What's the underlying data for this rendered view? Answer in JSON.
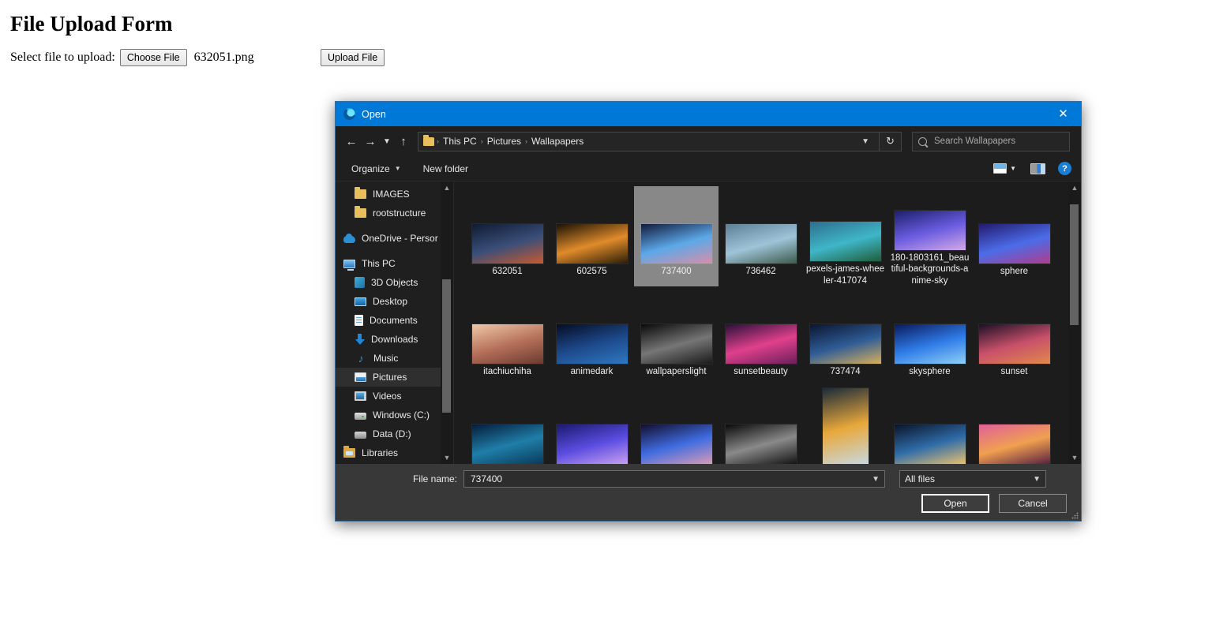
{
  "page": {
    "title": "File Upload Form",
    "select_label": "Select file to upload:",
    "choose_file_label": "Choose File",
    "chosen_file_name": "632051.png",
    "upload_button_label": "Upload File"
  },
  "dialog": {
    "title": "Open",
    "app_icon": "edge-browser-icon",
    "close_icon": "close-icon",
    "nav": {
      "back_icon": "back-arrow-icon",
      "forward_icon": "forward-arrow-icon",
      "recent_icon": "chevron-down-icon",
      "up_icon": "up-arrow-icon",
      "refresh_icon": "refresh-icon",
      "breadcrumb_caret": "chevron-down-icon"
    },
    "breadcrumb": [
      "This PC",
      "Pictures",
      "Wallapapers"
    ],
    "breadcrumb_separator": "›",
    "search": {
      "placeholder": "Search Wallapapers",
      "value": "",
      "icon": "search-icon"
    },
    "command_bar": {
      "organize_label": "Organize",
      "new_folder_label": "New folder",
      "view_icon": "view-layout-icon",
      "view_caret": "chevron-down-icon",
      "preview_pane_icon": "preview-pane-icon",
      "help_icon": "help-icon",
      "help_glyph": "?"
    },
    "nav_tree": [
      {
        "label": "IMAGES",
        "icon": "folder-icon",
        "kind": "folder",
        "indent": true,
        "selected": false
      },
      {
        "label": "rootstructure",
        "icon": "folder-icon",
        "kind": "folder",
        "indent": true,
        "selected": false
      },
      {
        "label": "",
        "icon": "spacer",
        "kind": "spacer",
        "indent": false,
        "selected": false
      },
      {
        "label": "OneDrive - Persor",
        "icon": "cloud-icon",
        "kind": "cloud",
        "indent": false,
        "selected": false
      },
      {
        "label": "",
        "icon": "spacer",
        "kind": "spacer",
        "indent": false,
        "selected": false
      },
      {
        "label": "This PC",
        "icon": "computer-icon",
        "kind": "pc",
        "indent": false,
        "selected": false
      },
      {
        "label": "3D Objects",
        "icon": "3d-objects-icon",
        "kind": "objects3d",
        "indent": true,
        "selected": false
      },
      {
        "label": "Desktop",
        "icon": "desktop-icon",
        "kind": "desktop",
        "indent": true,
        "selected": false
      },
      {
        "label": "Documents",
        "icon": "documents-icon",
        "kind": "docs",
        "indent": true,
        "selected": false
      },
      {
        "label": "Downloads",
        "icon": "downloads-icon",
        "kind": "dl",
        "indent": true,
        "selected": false
      },
      {
        "label": "Music",
        "icon": "music-note-icon",
        "kind": "music",
        "indent": true,
        "selected": false
      },
      {
        "label": "Pictures",
        "icon": "pictures-icon",
        "kind": "pics",
        "indent": true,
        "selected": true
      },
      {
        "label": "Videos",
        "icon": "videos-icon",
        "kind": "vids",
        "indent": true,
        "selected": false
      },
      {
        "label": "Windows (C:)",
        "icon": "disk-drive-icon",
        "kind": "drive",
        "indent": true,
        "selected": false
      },
      {
        "label": "Data (D:)",
        "icon": "disk-drive-icon",
        "kind": "drive2",
        "indent": true,
        "selected": false
      },
      {
        "label": "Libraries",
        "icon": "libraries-icon",
        "kind": "folder-lib",
        "indent": false,
        "selected": false
      }
    ],
    "nav_scrollbar": {
      "up_icon": "chevron-up-icon",
      "down_icon": "chevron-down-icon",
      "thumb_top_pct": 33,
      "thumb_height_pct": 52
    },
    "content_scrollbar": {
      "up_icon": "chevron-up-icon",
      "down_icon": "chevron-down-icon",
      "thumb_top_pct": 4,
      "thumb_height_pct": 47
    },
    "files": [
      {
        "name": "632051",
        "selected": false,
        "orientation": "landscape",
        "c1": "#0f1b33",
        "c2": "#3a4e78",
        "c3": "#c85a30"
      },
      {
        "name": "602575",
        "selected": false,
        "orientation": "landscape",
        "c1": "#1a1205",
        "c2": "#e08b2a",
        "c3": "#2a1d08"
      },
      {
        "name": "737400",
        "selected": true,
        "orientation": "landscape",
        "c1": "#121a3a",
        "c2": "#5ca8e8",
        "c3": "#d88fa8"
      },
      {
        "name": "736462",
        "selected": false,
        "orientation": "landscape",
        "c1": "#5c7f96",
        "c2": "#9fc4d8",
        "c3": "#3c5a4a"
      },
      {
        "name": "pexels-james-wheeler-417074",
        "selected": false,
        "orientation": "landscape",
        "c1": "#2d6e8c",
        "c2": "#3fb6c8",
        "c3": "#1f5e3a"
      },
      {
        "name": "180-1803161_beautiful-backgrounds-anime-sky",
        "selected": false,
        "orientation": "landscape",
        "c1": "#1b1f6b",
        "c2": "#6a5ce0",
        "c3": "#d3a8e8"
      },
      {
        "name": "sphere",
        "selected": false,
        "orientation": "landscape",
        "c1": "#241a6e",
        "c2": "#4b6ce8",
        "c3": "#b03c8c"
      },
      {
        "name": "itachiuchiha",
        "selected": false,
        "orientation": "landscape",
        "c1": "#f0c9a8",
        "c2": "#b5705a",
        "c3": "#6b3a2e"
      },
      {
        "name": "animedark",
        "selected": false,
        "orientation": "landscape",
        "c1": "#050c24",
        "c2": "#1d4a8c",
        "c3": "#2f78c0"
      },
      {
        "name": "wallpaperslight",
        "selected": false,
        "orientation": "landscape",
        "c1": "#0a0a0a",
        "c2": "#767676",
        "c3": "#1a1a1a"
      },
      {
        "name": "sunsetbeauty",
        "selected": false,
        "orientation": "landscape",
        "c1": "#2a0f3a",
        "c2": "#e0408c",
        "c3": "#6b1f5a"
      },
      {
        "name": "737474",
        "selected": false,
        "orientation": "landscape",
        "c1": "#0a1530",
        "c2": "#2f5c96",
        "c3": "#d8b05a"
      },
      {
        "name": "skysphere",
        "selected": false,
        "orientation": "landscape",
        "c1": "#0a1a5c",
        "c2": "#2f7ce8",
        "c3": "#8fd0f5"
      },
      {
        "name": "sunset",
        "selected": false,
        "orientation": "landscape",
        "c1": "#1c1026",
        "c2": "#c8506a",
        "c3": "#e08a4a"
      },
      {
        "name": "",
        "selected": false,
        "orientation": "landscape",
        "c1": "#051c3a",
        "c2": "#1f7ea8",
        "c3": "#0a3a5c"
      },
      {
        "name": "",
        "selected": false,
        "orientation": "landscape",
        "c1": "#1a1a6e",
        "c2": "#5a4ce0",
        "c3": "#c8a0f0"
      },
      {
        "name": "",
        "selected": false,
        "orientation": "landscape",
        "c1": "#120f2e",
        "c2": "#3f6ce0",
        "c3": "#d89ab8"
      },
      {
        "name": "",
        "selected": false,
        "orientation": "landscape",
        "c1": "#0a0a0a",
        "c2": "#8a8a8a",
        "c3": "#141414"
      },
      {
        "name": "",
        "selected": false,
        "orientation": "portrait",
        "c1": "#1a2a3a",
        "c2": "#e8a83a",
        "c3": "#c8d8e0"
      },
      {
        "name": "",
        "selected": false,
        "orientation": "landscape",
        "c1": "#0a1428",
        "c2": "#2f6ca8",
        "c3": "#e8c070"
      },
      {
        "name": "",
        "selected": false,
        "orientation": "landscape",
        "c1": "#e0609a",
        "c2": "#f0a050",
        "c3": "#5a2040"
      }
    ],
    "footer": {
      "filename_label": "File name:",
      "filename_value": "737400",
      "filename_caret": "chevron-down-icon",
      "filter_value": "All files",
      "filter_caret": "chevron-down-icon",
      "open_label": "Open",
      "cancel_label": "Cancel",
      "resize_grip": "resize-grip-icon"
    }
  },
  "colors": {
    "titlebar": "#0078d7",
    "dialog_bg": "#1f1f1f",
    "content_bg": "#1c1c1c",
    "footer_bg": "#383838",
    "selection": "#888888",
    "accent": "#1a7fd4"
  }
}
